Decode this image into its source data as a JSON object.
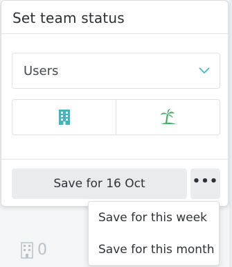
{
  "popover": {
    "title": "Set team status",
    "filter_select": {
      "value": "Users",
      "icon": "chevron-down-icon"
    },
    "status_options": [
      {
        "icon": "office-building-icon",
        "color": "#3fb5c4"
      },
      {
        "icon": "palm-tree-island-icon",
        "color": "#3fb062"
      }
    ],
    "save_button_label": "Save for 16 Oct",
    "more_button_icon": "more-dots-icon",
    "more_button_label": "•••"
  },
  "save_menu": {
    "items": [
      {
        "label": "Save for this week"
      },
      {
        "label": "Save for this month"
      }
    ]
  },
  "background": {
    "office_count": "0",
    "office_icon": "office-building-icon"
  },
  "colors": {
    "accent": "#3fb5c4",
    "vacation": "#3fb062",
    "button_bg": "#e9ebed"
  }
}
